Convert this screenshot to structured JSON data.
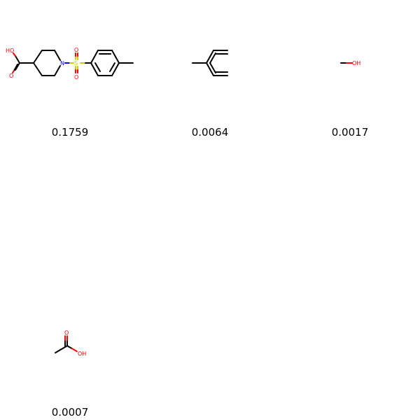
{
  "molecules": [
    {
      "legend": "0.1759",
      "atoms": {
        "ho": "HO",
        "o": "O",
        "n": "N",
        "s": "S",
        "o_top": "O",
        "o_bottom": "O"
      }
    },
    {
      "legend": "0.0064",
      "atoms": {}
    },
    {
      "legend": "0.0017",
      "atoms": {
        "oh": "OH"
      }
    },
    {
      "legend": "0.0007",
      "atoms": {
        "o": "O",
        "oh": "OH"
      }
    }
  ],
  "colors": {
    "carbon": "#000000",
    "oxygen": "#ff0000",
    "nitrogen": "#0000ff",
    "sulfur": "#cccc00"
  }
}
